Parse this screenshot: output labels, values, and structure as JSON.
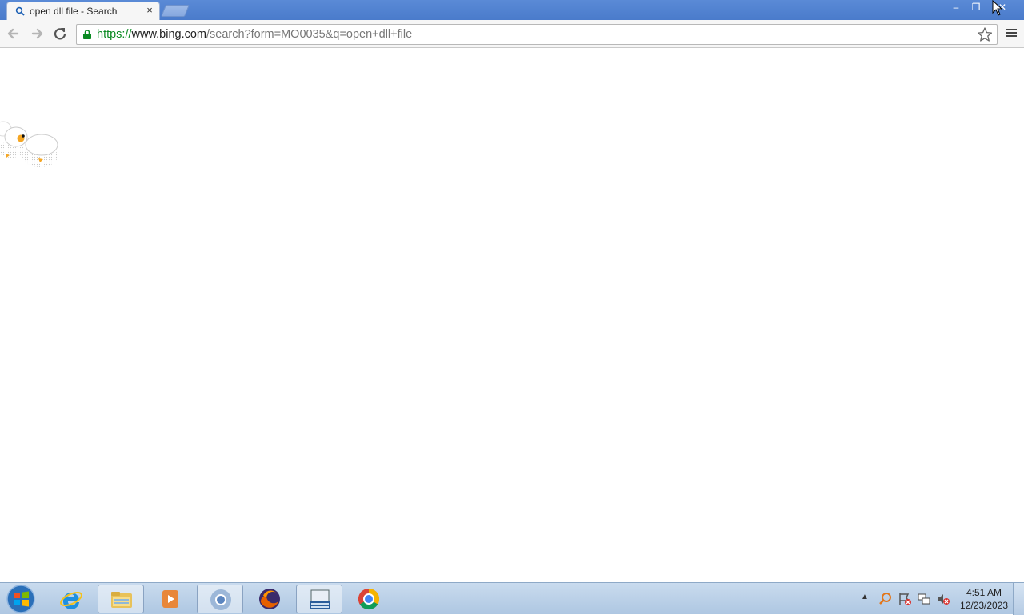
{
  "browser": {
    "tab": {
      "title": "open dll file - Search",
      "close": "×",
      "favicon": "search-icon"
    },
    "window_controls": {
      "minimize": "–",
      "maximize": "❐",
      "close": "✕"
    },
    "toolbar": {
      "back": "back-icon",
      "forward": "forward-icon",
      "reload": "reload-icon",
      "url_scheme": "https://",
      "url_host": "www.bing.com",
      "url_rest": "/search?form=MO0035&q=open+dll+file",
      "bookmark": "star-icon",
      "menu": "menu-icon"
    }
  },
  "taskbar": {
    "start": "windows-start-icon",
    "pinned": [
      {
        "name": "internet-explorer",
        "active": false
      },
      {
        "name": "file-explorer",
        "active": true
      },
      {
        "name": "media-player",
        "active": false
      },
      {
        "name": "chromium",
        "active": true
      },
      {
        "name": "firefox",
        "active": false
      },
      {
        "name": "on-screen-keyboard",
        "active": true
      },
      {
        "name": "chrome",
        "active": false
      }
    ],
    "clock": {
      "time": "4:51 AM",
      "date": "12/23/2023"
    }
  },
  "colors": {
    "titlebar": "#4a7bcb",
    "url_scheme": "#0a8a22",
    "taskbar": "#aec7e2"
  }
}
